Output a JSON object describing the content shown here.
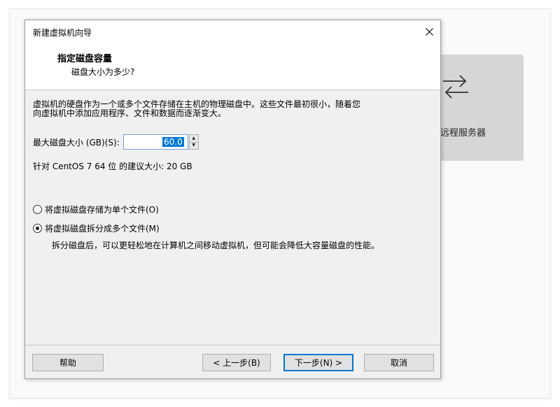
{
  "background_panel": {
    "remote_label": "远程服务器"
  },
  "dialog": {
    "title": "新建虚拟机向导",
    "header": {
      "title": "指定磁盘容量",
      "subtitle": "磁盘大小为多少?"
    },
    "description_line1": "虚拟机的硬盘作为一个或多个文件存储在主机的物理磁盘中。这些文件最初很小，随着您",
    "description_line2": "向虚拟机中添加应用程序、文件和数据而逐渐变大。",
    "max_disk_label": "最大磁盘大小 (GB)(S):",
    "max_disk_value": "60.0",
    "recommend_text": "针对 CentOS 7 64 位 的建议大小: 20 GB",
    "options": [
      {
        "label": "将虚拟磁盘存储为单个文件(O)",
        "checked": false
      },
      {
        "label": "将虚拟磁盘拆分成多个文件(M)",
        "checked": true
      }
    ],
    "split_description": "拆分磁盘后，可以更轻松地在计算机之间移动虚拟机，但可能会降低大容量磁盘的性能。",
    "buttons": {
      "help": "帮助",
      "back": "< 上一步(B)",
      "next": "下一步(N) >",
      "cancel": "取消"
    }
  },
  "colors": {
    "accent": "#0078d7",
    "dialog_bg": "#f0f0f0",
    "tile_bg": "#d6d6d6"
  }
}
